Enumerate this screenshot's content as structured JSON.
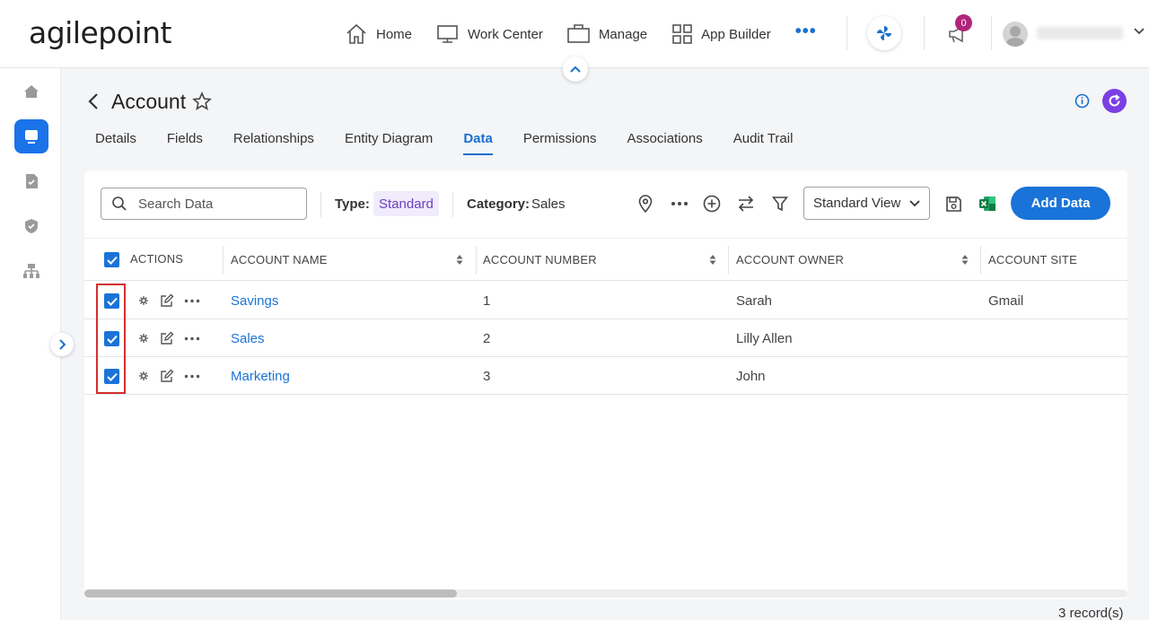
{
  "app": {
    "logo": "agilepoint",
    "notification_count": "0"
  },
  "topnav": {
    "items": [
      {
        "label": "Home",
        "icon": "home-icon"
      },
      {
        "label": "Work Center",
        "icon": "monitor-icon"
      },
      {
        "label": "Manage",
        "icon": "briefcase-icon"
      },
      {
        "label": "App Builder",
        "icon": "grid-icon"
      }
    ],
    "more": "•••"
  },
  "sidebar": {
    "items": [
      {
        "icon": "home-icon",
        "active": false
      },
      {
        "icon": "data-entity-icon",
        "active": true
      },
      {
        "icon": "document-check-icon",
        "active": false
      },
      {
        "icon": "shield-check-icon",
        "active": false
      },
      {
        "icon": "hierarchy-icon",
        "active": false
      }
    ]
  },
  "page": {
    "title": "Account",
    "tabs": [
      "Details",
      "Fields",
      "Relationships",
      "Entity Diagram",
      "Data",
      "Permissions",
      "Associations",
      "Audit Trail"
    ],
    "active_tab": "Data"
  },
  "toolbar": {
    "search_placeholder": "Search Data",
    "type_label": "Type:",
    "type_value": "Standard",
    "category_label": "Category:",
    "category_value": "Sales",
    "view_select": "Standard View",
    "add_button": "Add Data"
  },
  "table": {
    "columns": [
      "ACTIONS",
      "ACCOUNT NAME",
      "ACCOUNT NUMBER",
      "ACCOUNT OWNER",
      "ACCOUNT SITE"
    ],
    "rows": [
      {
        "name": "Savings",
        "number": "1",
        "owner": "Sarah",
        "site": "Gmail",
        "checked": true
      },
      {
        "name": "Sales",
        "number": "2",
        "owner": "Lilly Allen",
        "site": "",
        "checked": true
      },
      {
        "name": "Marketing",
        "number": "3",
        "owner": "John",
        "site": "",
        "checked": true
      }
    ],
    "header_checked": true
  },
  "footer": {
    "records": "3 record(s)"
  },
  "colors": {
    "accent": "#1a73d8",
    "type_chip_bg": "#f0ecfb",
    "type_chip_text": "#6b3fc4",
    "badge": "#b0257a",
    "refresh": "#7b3fe4",
    "highlight": "#d32f2f"
  }
}
